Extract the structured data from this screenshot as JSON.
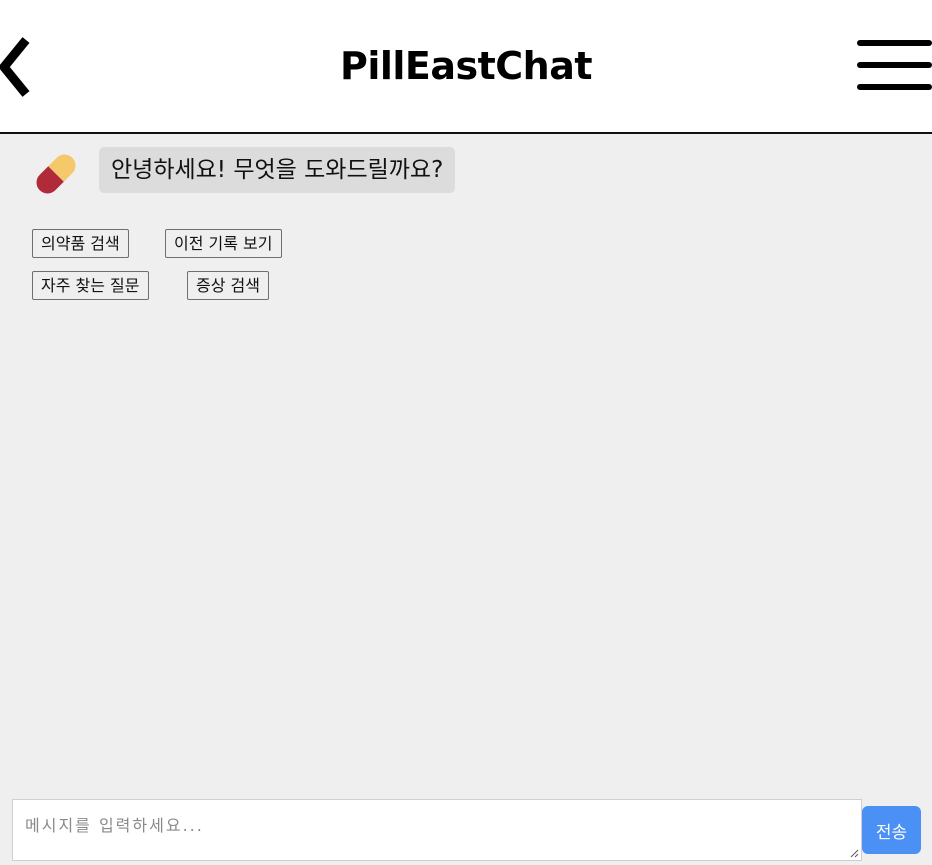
{
  "header": {
    "title": "PillEastChat",
    "back_icon": "chevron-left-icon",
    "menu_icon": "hamburger-menu-icon"
  },
  "chat": {
    "avatar_icon": "pill-capsule-icon",
    "greeting": "안녕하세요! 무엇을 도와드릴까요?",
    "quick_replies": [
      {
        "label": "의약품 검색"
      },
      {
        "label": "이전 기록 보기"
      },
      {
        "label": "자주 찾는 질문"
      },
      {
        "label": "증상 검색"
      }
    ]
  },
  "composer": {
    "placeholder": "메시지를 입력하세요...",
    "value": "",
    "send_label": "전송"
  },
  "colors": {
    "background": "#efefef",
    "header_bg": "#ffffff",
    "bubble_bg": "#dcdcdc",
    "send_button": "#4a90f5",
    "pill_yellow": "#f5c96a",
    "pill_red": "#b02a3a"
  }
}
